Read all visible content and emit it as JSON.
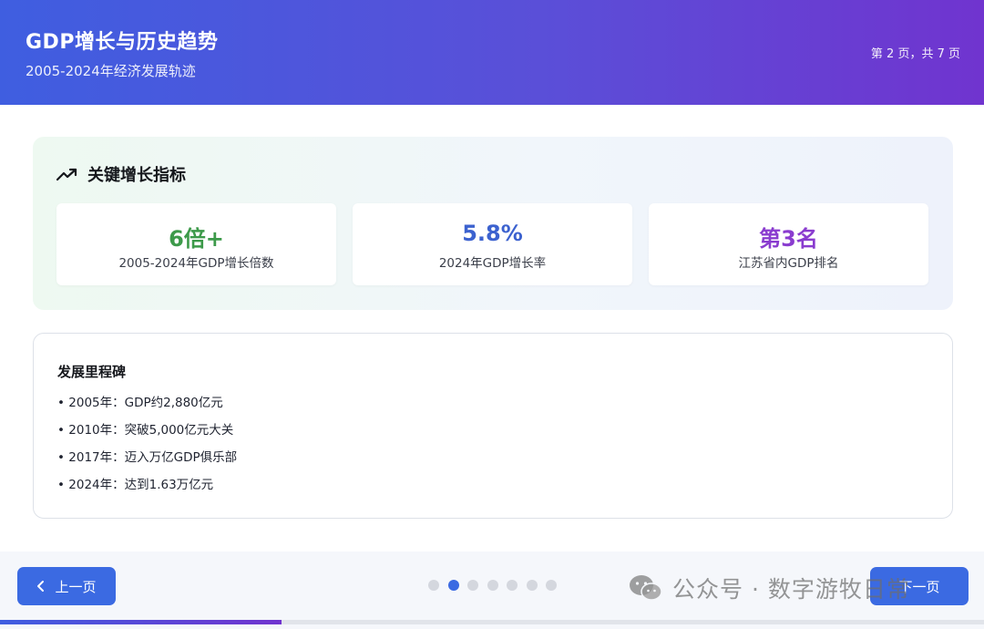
{
  "header": {
    "title": "GDP增长与历史趋势",
    "subtitle": "2005-2024年经济发展轨迹",
    "page_indicator": "第 2 页，共 7 页"
  },
  "metrics": {
    "heading": "关键增长指标",
    "heading_icon": "trending-up-icon",
    "cards": [
      {
        "value": "6倍+",
        "label": "2005-2024年GDP增长倍数",
        "color": "#3d9a4a"
      },
      {
        "value": "5.8%",
        "label": "2024年GDP增长率",
        "color": "#3c62cf"
      },
      {
        "value": "第3名",
        "label": "江苏省内GDP排名",
        "color": "#8a3ccf"
      }
    ]
  },
  "milestones": {
    "title": "发展里程碑",
    "items": [
      "2005年：GDP约2,880亿元",
      "2010年：突破5,000亿元大关",
      "2017年：迈入万亿GDP俱乐部",
      "2024年：达到1.63万亿元"
    ]
  },
  "footer": {
    "prev_label": "上一页",
    "next_label": "下一页",
    "total_pages": 7,
    "current_page": 2,
    "progress_fraction": 0.2857,
    "watermark": "公众号 · 数字游牧日常"
  },
  "colors": {
    "accent": "#3b6ae2",
    "header_gradient_start": "#3f5ee0",
    "header_gradient_end": "#7034cf"
  }
}
